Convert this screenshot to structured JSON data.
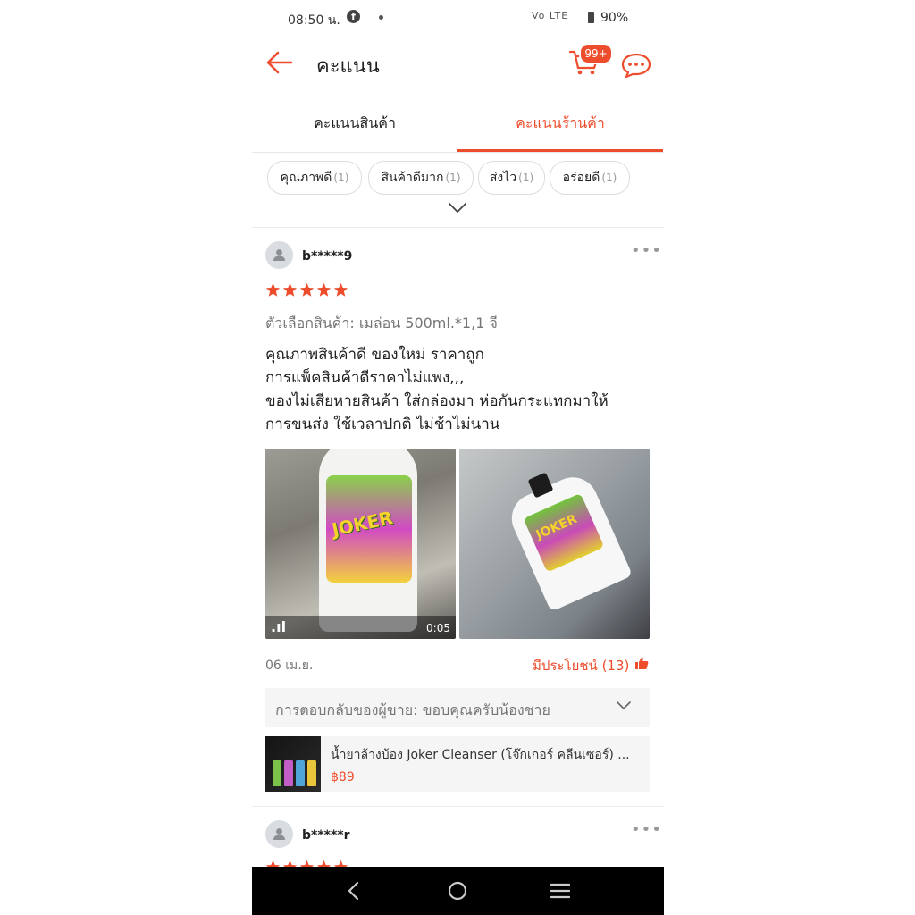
{
  "status_bar": {
    "time": "08:50 น.",
    "fb": "f",
    "signal": "Vo LTE",
    "battery": "90%"
  },
  "header": {
    "title": "คะแนน",
    "cart_badge": "99+"
  },
  "tabs": [
    {
      "label": "คะแนนสินค้า",
      "active": false
    },
    {
      "label": "คะแนนร้านค้า",
      "active": true
    }
  ],
  "chips": [
    {
      "label": "คุณภาพดี",
      "count": "(1)"
    },
    {
      "label": "สินค้าดีมาก",
      "count": "(1)"
    },
    {
      "label": "ส่งไว",
      "count": "(1)"
    },
    {
      "label": "อร่อยดี",
      "count": "(1)"
    }
  ],
  "review1": {
    "user": "b*****9",
    "rating": 5,
    "more": "•••",
    "variant": "ตัวเลือกสินค้า: เมล่อน 500ml.*1,1 จี",
    "lines": [
      "คุณภาพสินค้าดี ของใหม่ ราคาถูก",
      "การแพ็คสินค้าดีราคาไม่แพง,,,",
      "ของไม่เสียหายสินค้า ใส่กล่องมา ห่อกันกระแทกมาให้",
      "การขนส่ง ใช้เวลาปกติ ไม่ช้าไม่นาน"
    ],
    "media": {
      "video_duration": "0:05",
      "video_icon": ".ıl",
      "bottle_text_1": "JOKER",
      "bottle_text_2": "JOKER"
    },
    "date": "06 เม.ย.",
    "helpful": "มีประโยชน์ (13)",
    "seller_reply": "การตอบกลับของผู้ขาย: ขอบคุณครับน้องชาย",
    "product": {
      "name": "น้ำยาล้างบ้อง Joker Cleanser (โจ๊กเกอร์ คลีนเซอร์) ...",
      "price": "฿89"
    }
  },
  "review2": {
    "user": "b*****r",
    "more": "•••",
    "rating": 5
  },
  "colors": {
    "accent": "#ee4d2d",
    "star": "#ee4d2d",
    "text": "#222222",
    "muted": "#757575"
  },
  "icons": [
    "arrow-left-icon",
    "cart-icon",
    "chat-icon",
    "chevron-down-icon",
    "user-icon",
    "star-icon",
    "thumbs-up-icon",
    "nav-back-icon",
    "nav-home-icon",
    "nav-recents-icon"
  ]
}
